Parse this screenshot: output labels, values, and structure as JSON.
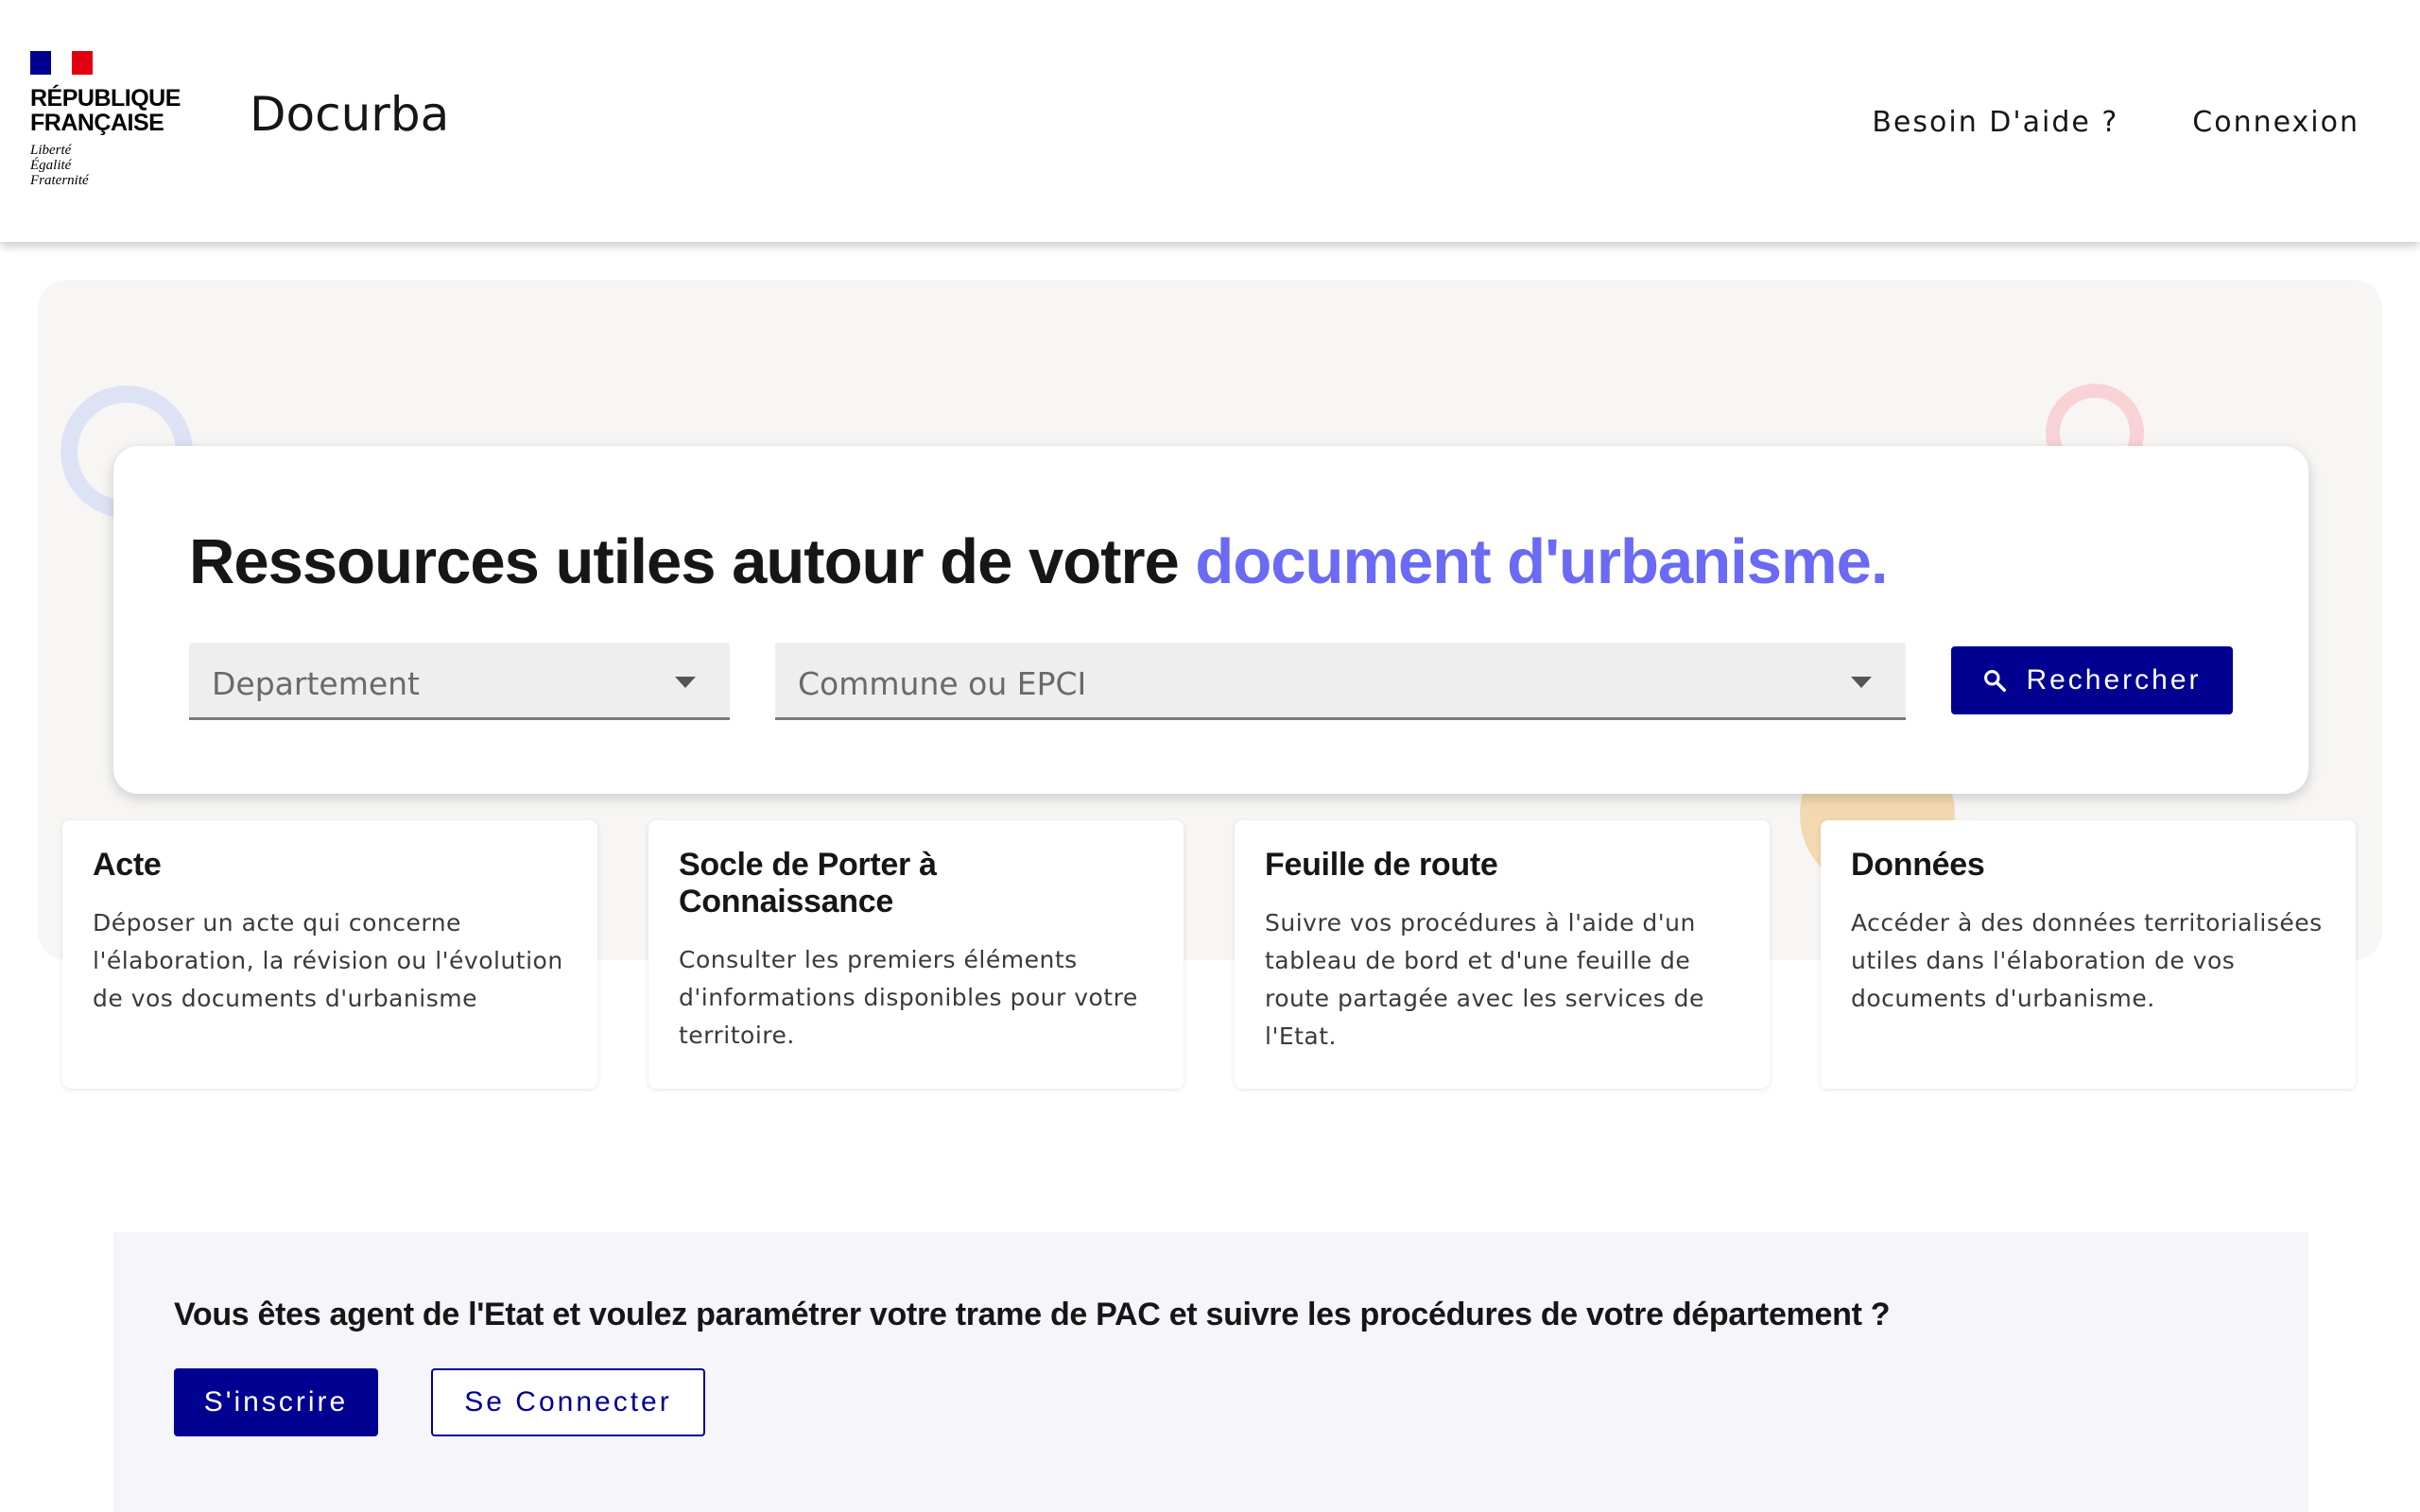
{
  "header": {
    "logo": {
      "line1": "RÉPUBLIQUE",
      "line2": "FRANÇAISE",
      "motto1": "Liberté",
      "motto2": "Égalité",
      "motto3": "Fraternité"
    },
    "site_title": "Docurba",
    "nav": {
      "help": "Besoin D'aide ?",
      "login": "Connexion"
    }
  },
  "hero": {
    "title_main": "Ressources utiles autour de votre",
    "title_accent": "document d'urbanisme.",
    "department_select": {
      "placeholder": "Departement"
    },
    "commune_select": {
      "placeholder": "Commune ou EPCI"
    },
    "search_button": "Rechercher"
  },
  "cards": [
    {
      "title": "Acte",
      "text": "Déposer un acte qui concerne l'élaboration, la révision ou l'évolution de vos documents d'urbanisme"
    },
    {
      "title": "Socle de Porter à Connaissance",
      "text": "Consulter les premiers éléments d'informations disponibles pour votre territoire."
    },
    {
      "title": "Feuille de route",
      "text": "Suivre vos procédures à l'aide d'un tableau de bord et d'une feuille de route partagée avec les services de l'Etat."
    },
    {
      "title": "Données",
      "text": "Accéder à des données territorialisées utiles dans l'élaboration de vos documents d'urbanisme."
    }
  ],
  "agent": {
    "question": "Vous êtes agent de l'Etat et voulez paramétrer votre trame de PAC et suivre les procédures de votre département ?",
    "signup": "S'inscrire",
    "signin": "Se Connecter"
  },
  "colors": {
    "primary": "#000091",
    "accent": "#6a6af4",
    "hero_bg": "#f7f6f4",
    "agent_bg": "#f5f5fa",
    "marianne_red": "#e1000f"
  }
}
